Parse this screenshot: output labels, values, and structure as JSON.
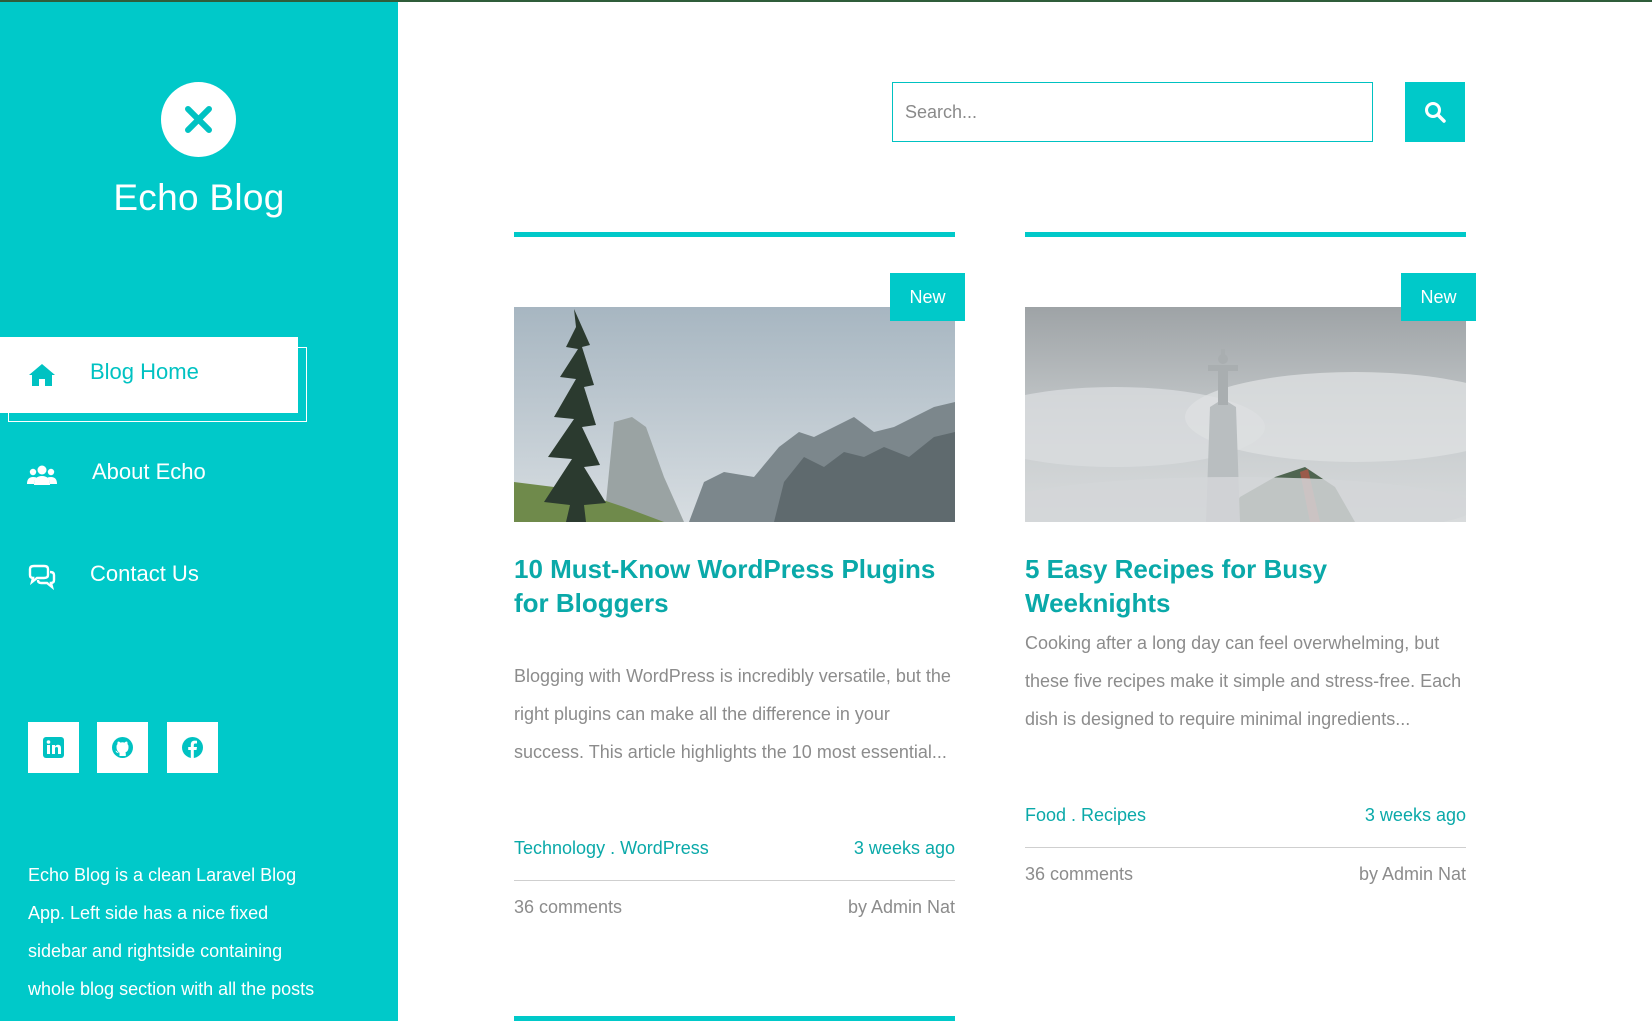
{
  "sidebar": {
    "brand": "Echo Blog",
    "nav": [
      {
        "label": "Blog Home",
        "icon": "home-icon",
        "active": true
      },
      {
        "label": "About Echo",
        "icon": "users-icon",
        "active": false
      },
      {
        "label": "Contact Us",
        "icon": "chat-icon",
        "active": false
      }
    ],
    "social": [
      "linkedin-icon",
      "github-icon",
      "facebook-icon"
    ],
    "about": "Echo Blog is a clean Laravel Blog App. Left side has a nice fixed sidebar and rightside containing whole blog section with all the posts"
  },
  "search": {
    "placeholder": "Search..."
  },
  "posts": [
    {
      "badge": "New",
      "title": "10 Must-Know WordPress Plugins for Bloggers",
      "excerpt": "Blogging with WordPress is incredibly versatile, but the right plugins can make all the difference in your success. This article highlights the 10 most essential...",
      "categories": "Technology . WordPress",
      "time": "3 weeks ago",
      "comments": "36 comments",
      "author": "by Admin Nat"
    },
    {
      "badge": "New",
      "title": "5 Easy Recipes for Busy Weeknights",
      "excerpt": "Cooking after a long day can feel overwhelming, but these five recipes make it simple and stress-free. Each dish is designed to require minimal ingredients...",
      "categories": "Food . Recipes",
      "time": "3 weeks ago",
      "comments": "36 comments",
      "author": "by Admin Nat"
    }
  ],
  "colors": {
    "accent": "#00c9c9",
    "link": "#0aa9a9",
    "muted": "#8c8c8c"
  }
}
